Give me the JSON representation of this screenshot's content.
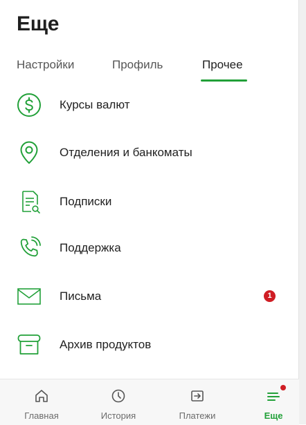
{
  "header": {
    "title": "Еще"
  },
  "tabs": [
    {
      "label": "Настройки"
    },
    {
      "label": "Профиль"
    },
    {
      "label": "Прочее",
      "active": true
    }
  ],
  "menu": {
    "items": [
      {
        "label": "Курсы валют",
        "icon": "dollar-circle-icon"
      },
      {
        "label": "Отделения и банкоматы",
        "icon": "location-pin-icon"
      },
      {
        "label": "Подписки",
        "icon": "document-search-icon"
      },
      {
        "label": "Поддержка",
        "icon": "phone-call-icon"
      },
      {
        "label": "Письма",
        "icon": "envelope-icon",
        "badge": "1"
      },
      {
        "label": "Архив продуктов",
        "icon": "archive-box-icon"
      }
    ]
  },
  "bottom_nav": {
    "items": [
      {
        "label": "Главная",
        "icon": "home-icon"
      },
      {
        "label": "История",
        "icon": "clock-icon"
      },
      {
        "label": "Платежи",
        "icon": "payment-arrow-icon"
      },
      {
        "label": "Еще",
        "icon": "menu-lines-icon",
        "active": true,
        "has_notification_dot": true
      }
    ]
  },
  "colors": {
    "accent": "#21a038",
    "text_primary": "#1f1f1f",
    "text_secondary": "#6b6b6b",
    "badge": "#cf1d24",
    "nav_background": "#f7f7f7"
  }
}
